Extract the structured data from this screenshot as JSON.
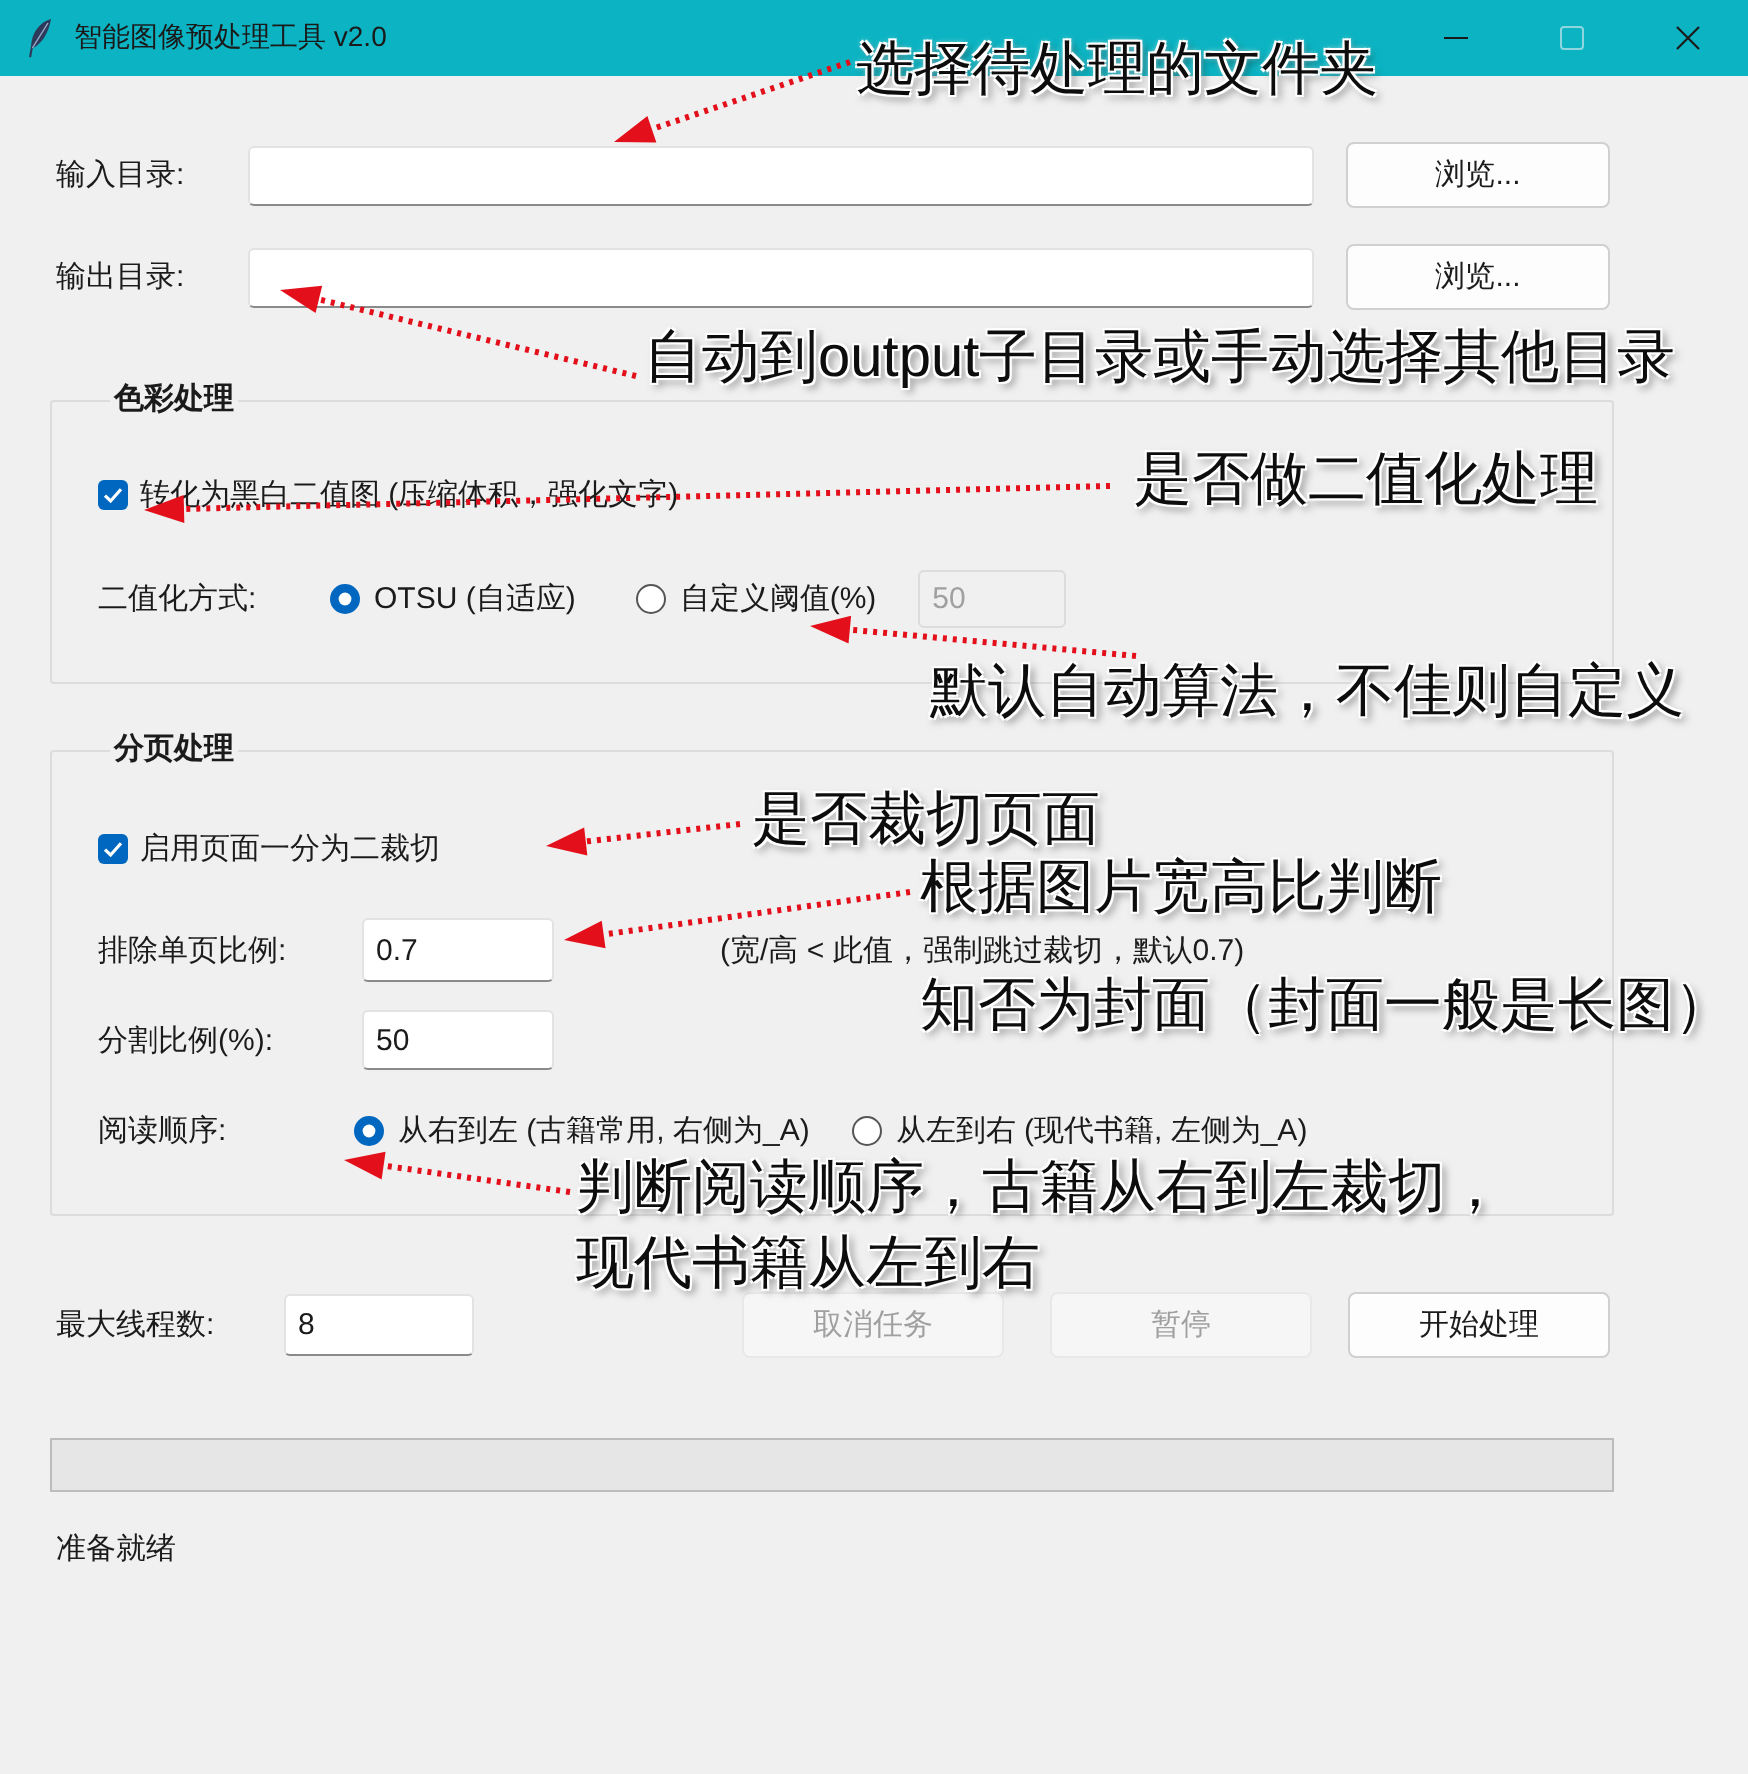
{
  "window": {
    "title": "智能图像预处理工具 v2.0",
    "controls": [
      {
        "kind": "minimize",
        "disabled": false
      },
      {
        "kind": "maximize",
        "disabled": true
      },
      {
        "kind": "close",
        "disabled": false
      }
    ]
  },
  "directories": [
    {
      "label": "输入目录:",
      "button": "浏览..."
    },
    {
      "label": "输出目录:",
      "button": "浏览..."
    }
  ],
  "color_group": {
    "title": "色彩处理",
    "checkbox": {
      "label": "转化为黑白二值图 (压缩体积，强化文字)",
      "checked": true
    },
    "mode": {
      "label": "二值化方式:",
      "options": [
        {
          "label": "OTSU (自适应)",
          "selected": true
        },
        {
          "label": "自定义阈值(%)",
          "selected": false
        }
      ],
      "threshold": {
        "value": "50",
        "disabled": true
      }
    }
  },
  "split_group": {
    "title": "分页处理",
    "checkbox": {
      "label": "启用页面一分为二裁切",
      "checked": true
    },
    "fields": [
      {
        "label": "排除单页比例:",
        "value": "0.7",
        "hint": "(宽/高 < 此值，强制跳过裁切，默认0.7)"
      },
      {
        "label": "分割比例(%):",
        "value": "50"
      }
    ],
    "order": {
      "label": "阅读顺序:",
      "options": [
        {
          "label": "从右到左 (古籍常用, 右侧为_A)",
          "selected": true
        },
        {
          "label": "从左到右 (现代书籍, 左侧为_A)",
          "selected": false
        }
      ]
    }
  },
  "threads": {
    "label": "最大线程数:",
    "value": "8"
  },
  "buttons": [
    {
      "label": "取消任务",
      "disabled": true
    },
    {
      "label": "暂停",
      "disabled": true
    },
    {
      "label": "开始处理",
      "disabled": false
    }
  ],
  "progress": {
    "level": 0
  },
  "status": "准备就绪",
  "annotations": [
    {
      "lines": [
        "选择待处理的文件夹"
      ]
    },
    {
      "lines": [
        "自动到output子目录或手动选择其他目录"
      ]
    },
    {
      "lines": [
        "是否做二值化处理"
      ]
    },
    {
      "lines": [
        "默认自动算法，不佳则自定义"
      ]
    },
    {
      "lines": [
        "是否裁切页面"
      ]
    },
    {
      "lines": [
        "根据图片宽高比判断",
        "知否为封面（封面一般是长图）"
      ]
    },
    {
      "lines": [
        "判断阅读顺序，古籍从右到左裁切，",
        "现代书籍从左到右"
      ]
    }
  ]
}
